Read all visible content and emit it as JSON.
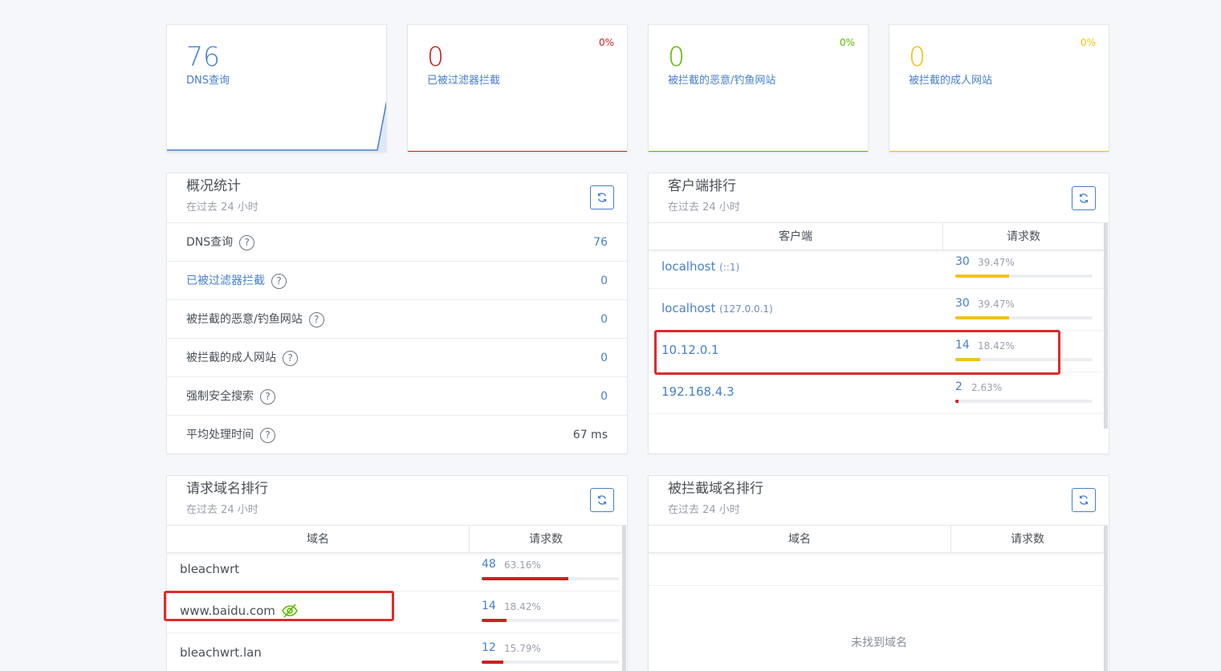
{
  "colors": {
    "blue": "#467fcf",
    "red": "#cd201f",
    "green": "#5eba00",
    "yellow": "#f1c40f"
  },
  "stats": [
    {
      "value": "76",
      "label": "DNS查询",
      "percent": "",
      "color": "#467fcf"
    },
    {
      "value": "0",
      "label": "已被过滤器拦截",
      "percent": "0%",
      "color": "#cd201f"
    },
    {
      "value": "0",
      "label": "被拦截的恶意/钓鱼网站",
      "percent": "0%",
      "color": "#5eba00"
    },
    {
      "value": "0",
      "label": "被拦截的成人网站",
      "percent": "0%",
      "color": "#f1c40f"
    }
  ],
  "overview": {
    "title": "概况统计",
    "subtitle": "在过去 24 小时",
    "rows": [
      {
        "label": "DNS查询",
        "value": "76"
      },
      {
        "label": "已被过滤器拦截",
        "value": "0"
      },
      {
        "label": "被拦截的恶意/钓鱼网站",
        "value": "0"
      },
      {
        "label": "被拦截的成人网站",
        "value": "0"
      },
      {
        "label": "强制安全搜索",
        "value": "0"
      },
      {
        "label": "平均处理时间",
        "value": "67 ms"
      }
    ]
  },
  "clients": {
    "title": "客户端排行",
    "subtitle": "在过去 24 小时",
    "col_client": "客户端",
    "col_requests": "请求数",
    "rows": [
      {
        "name": "localhost",
        "sub": "(::1)",
        "count": "30",
        "percent": "39.47%",
        "fraction": 0.3947,
        "bar_color": "#f1c40f"
      },
      {
        "name": "localhost",
        "sub": "(127.0.0.1)",
        "count": "30",
        "percent": "39.47%",
        "fraction": 0.3947,
        "bar_color": "#f1c40f"
      },
      {
        "name": "10.12.0.1",
        "sub": "",
        "count": "14",
        "percent": "18.42%",
        "fraction": 0.1842,
        "bar_color": "#f1c40f"
      },
      {
        "name": "192.168.4.3",
        "sub": "",
        "count": "2",
        "percent": "2.63%",
        "fraction": 0.0263,
        "bar_color": "#cd201f"
      }
    ]
  },
  "domains": {
    "title": "请求域名排行",
    "subtitle": "在过去 24 小时",
    "col_domain": "域名",
    "col_requests": "请求数",
    "rows": [
      {
        "name": "bleachwrt",
        "count": "48",
        "percent": "63.16%",
        "fraction": 0.6316,
        "bar_color": "#cd201f"
      },
      {
        "name": "www.baidu.com",
        "count": "14",
        "percent": "18.42%",
        "fraction": 0.1842,
        "bar_color": "#cd201f",
        "icon": "eye-slash-icon"
      },
      {
        "name": "bleachwrt.lan",
        "count": "12",
        "percent": "15.79%",
        "fraction": 0.1579,
        "bar_color": "#cd201f"
      }
    ]
  },
  "blocked": {
    "title": "被拦截域名排行",
    "subtitle": "在过去 24 小时",
    "col_domain": "域名",
    "col_requests": "请求数",
    "empty": "未找到域名"
  }
}
